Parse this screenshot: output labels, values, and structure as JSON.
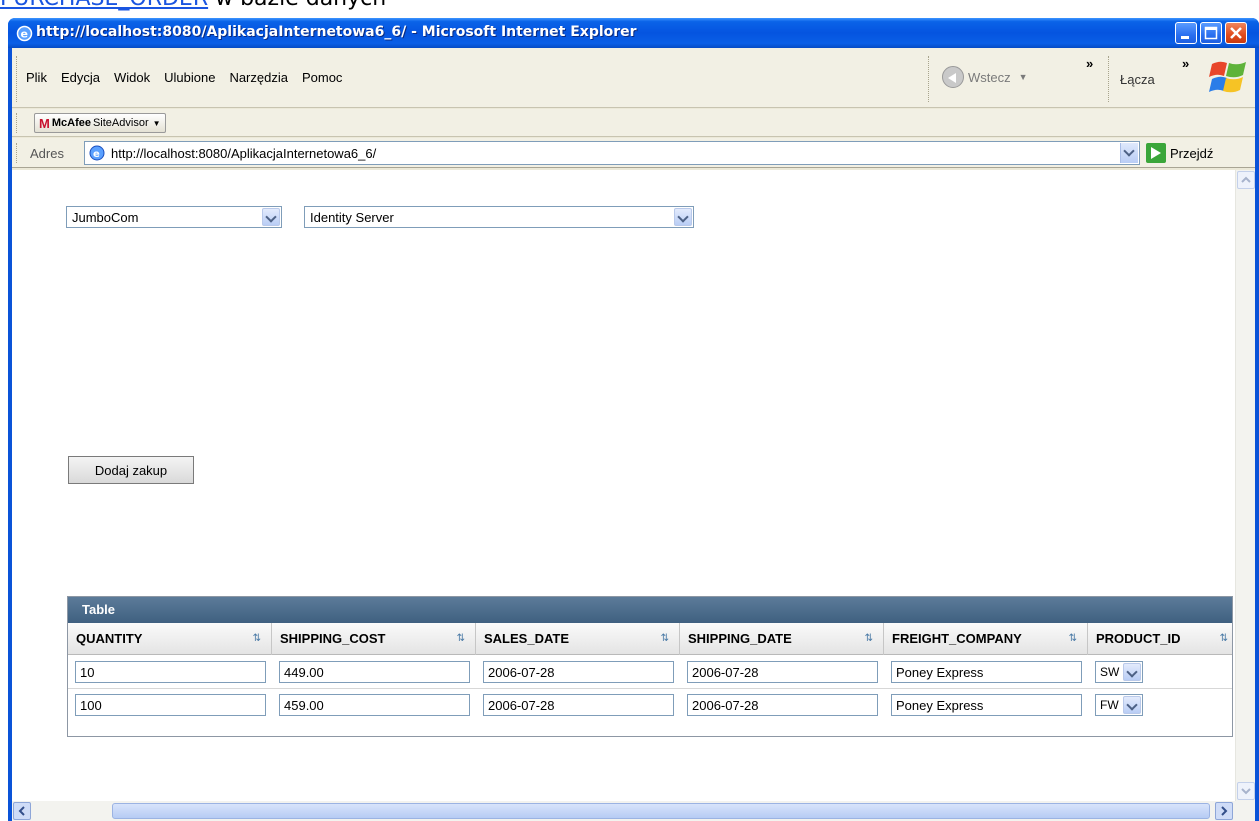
{
  "caption": {
    "link": "PURCHASE_ORDER",
    "rest": " w bazie danych"
  },
  "window": {
    "title": "http://localhost:8080/AplikacjaInternetowa6_6/ - Microsoft Internet Explorer"
  },
  "menu": {
    "items": [
      "Plik",
      "Edycja",
      "Widok",
      "Ulubione",
      "Narzędzia",
      "Pomoc"
    ],
    "back_label": "Wstecz",
    "links_label": "Łącza",
    "chevron": "»"
  },
  "toolbar": {
    "mcafee_brand": "McAfee",
    "mcafee_product": "SiteAdvisor"
  },
  "address": {
    "label": "Adres",
    "url": "http://localhost:8080/AplikacjaInternetowa6_6/",
    "go_label": "Przejdź"
  },
  "form": {
    "company_select": "JumboCom",
    "product_select": "Identity Server",
    "add_button": "Dodaj zakup"
  },
  "table": {
    "title": "Table",
    "columns": [
      "QUANTITY",
      "SHIPPING_COST",
      "SALES_DATE",
      "SHIPPING_DATE",
      "FREIGHT_COMPANY",
      "PRODUCT_ID"
    ],
    "sort_glyph": "⇅",
    "rows": [
      {
        "quantity": "10",
        "shipping_cost": "449.00",
        "sales_date": "2006-07-28",
        "shipping_date": "2006-07-28",
        "freight_company": "Poney Express",
        "product_id": "SW"
      },
      {
        "quantity": "100",
        "shipping_cost": "459.00",
        "sales_date": "2006-07-28",
        "shipping_date": "2006-07-28",
        "freight_company": "Poney Express",
        "product_id": "FW"
      }
    ]
  },
  "colors": {
    "titlebar": "#0554e0",
    "close_button": "#e04b1c",
    "table_header": "#3f6080",
    "link": "#1a55e0"
  },
  "icons": [
    "ie-icon",
    "minimize-icon",
    "maximize-icon",
    "close-icon",
    "back-arrow-icon",
    "windows-logo-icon",
    "mcafee-icon",
    "page-icon",
    "go-arrow-icon",
    "chevron-down-icon",
    "sort-icon",
    "scroll-up-icon",
    "scroll-down-icon",
    "scroll-left-icon",
    "scroll-right-icon"
  ]
}
